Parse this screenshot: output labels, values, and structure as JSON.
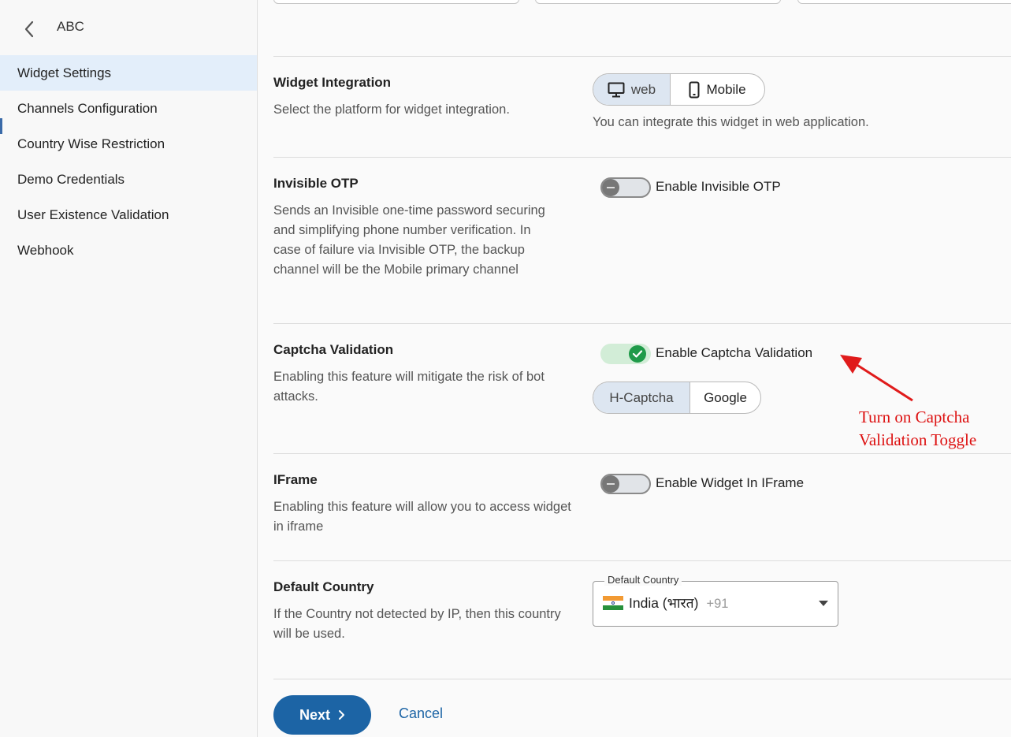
{
  "sidebar": {
    "title": "ABC",
    "items": [
      {
        "label": "Widget Settings",
        "active": true
      },
      {
        "label": "Channels Configuration",
        "active": false
      },
      {
        "label": "Country Wise Restriction",
        "active": false
      },
      {
        "label": "Demo Credentials",
        "active": false
      },
      {
        "label": "User Existence Validation",
        "active": false
      },
      {
        "label": "Webhook",
        "active": false
      }
    ]
  },
  "widget_integration": {
    "title": "Widget Integration",
    "description": "Select the platform for widget integration.",
    "options": [
      {
        "label": "web",
        "icon": "monitor-icon",
        "selected": true
      },
      {
        "label": "Mobile",
        "icon": "mobile-phone-icon",
        "selected": false
      }
    ],
    "hint": "You can integrate this widget in web application."
  },
  "invisible_otp": {
    "title": "Invisible OTP",
    "description": "Sends an Invisible one-time password securing and simplifying phone number verification. In case of failure via Invisible OTP, the backup channel will be the Mobile primary channel",
    "toggle_label": "Enable Invisible OTP",
    "enabled": false
  },
  "captcha_validation": {
    "title": "Captcha Validation",
    "description": "Enabling this feature will mitigate the risk of bot attacks.",
    "toggle_label": "Enable Captcha Validation",
    "enabled": true,
    "options": [
      {
        "label": "H-Captcha",
        "selected": true
      },
      {
        "label": "Google",
        "selected": false
      }
    ]
  },
  "iframe": {
    "title": "IFrame",
    "description": "Enabling this feature will allow you to access widget in iframe",
    "toggle_label": "Enable Widget In IFrame",
    "enabled": false
  },
  "default_country": {
    "title": "Default Country",
    "description": "If the Country not detected by IP, then this country will be used.",
    "field_label": "Default Country",
    "value": "India (भारत)",
    "dial_code": "+91"
  },
  "actions": {
    "next_label": "Next",
    "cancel_label": "Cancel"
  },
  "annotation": {
    "text": "Turn on Captcha\nValidation Toggle",
    "color": "#dd1111"
  },
  "colors": {
    "accent": "#1c64a5",
    "toggle_on": "#1f9a49",
    "active_nav_bg": "#e3eefa"
  }
}
